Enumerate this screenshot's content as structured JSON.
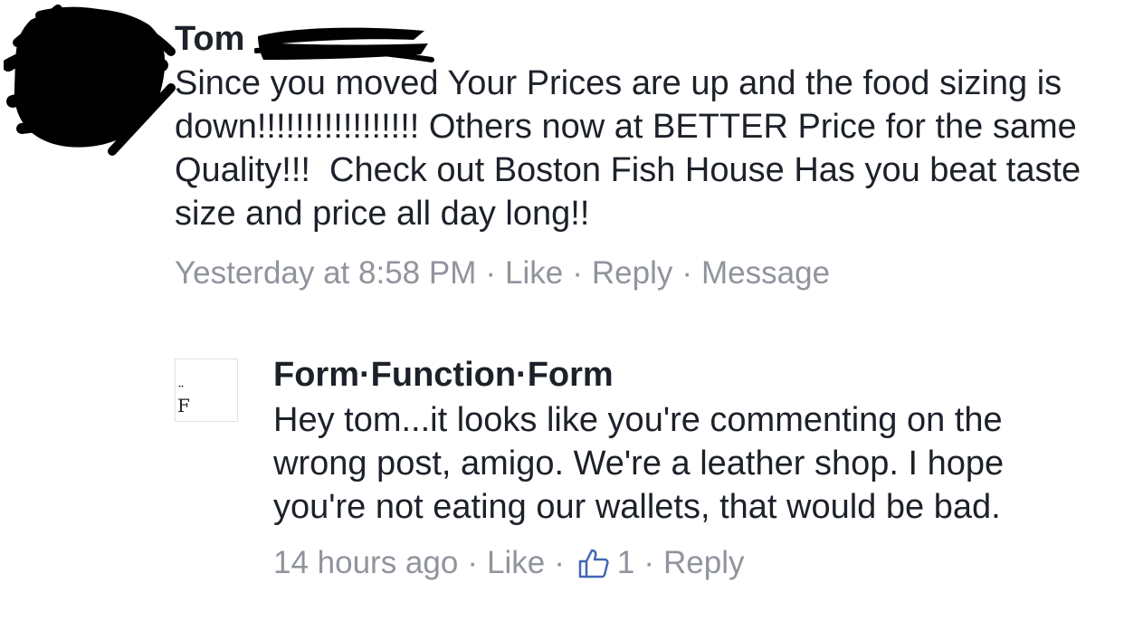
{
  "comment1": {
    "author": "Tom",
    "body": "Since you moved Your Prices are up and the food sizing is down!!!!!!!!!!!!!!!!! Others now at BETTER Price for the same Quality!!!  Check out Boston Fish House Has you beat taste size and price all day long!!",
    "timestamp": "Yesterday at 8:58 PM",
    "actions": {
      "like": "Like",
      "reply": "Reply",
      "message": "Message"
    }
  },
  "comment2": {
    "author": "Form·Function·Form",
    "avatar_letter": "F",
    "avatar_dots": "¨",
    "body": "Hey tom...it looks like you're commenting on the wrong post, amigo. We're a leather shop. I hope you're not eating our wallets, that would be bad.",
    "timestamp": "14 hours ago",
    "actions": {
      "like": "Like",
      "like_count": "1",
      "reply": "Reply"
    }
  },
  "separator": "·",
  "colors": {
    "text": "#1d2129",
    "meta": "#90949c",
    "like_icon": "#4267b2",
    "redaction": "#000000"
  },
  "icons": {
    "like": "thumbs-up-icon"
  }
}
